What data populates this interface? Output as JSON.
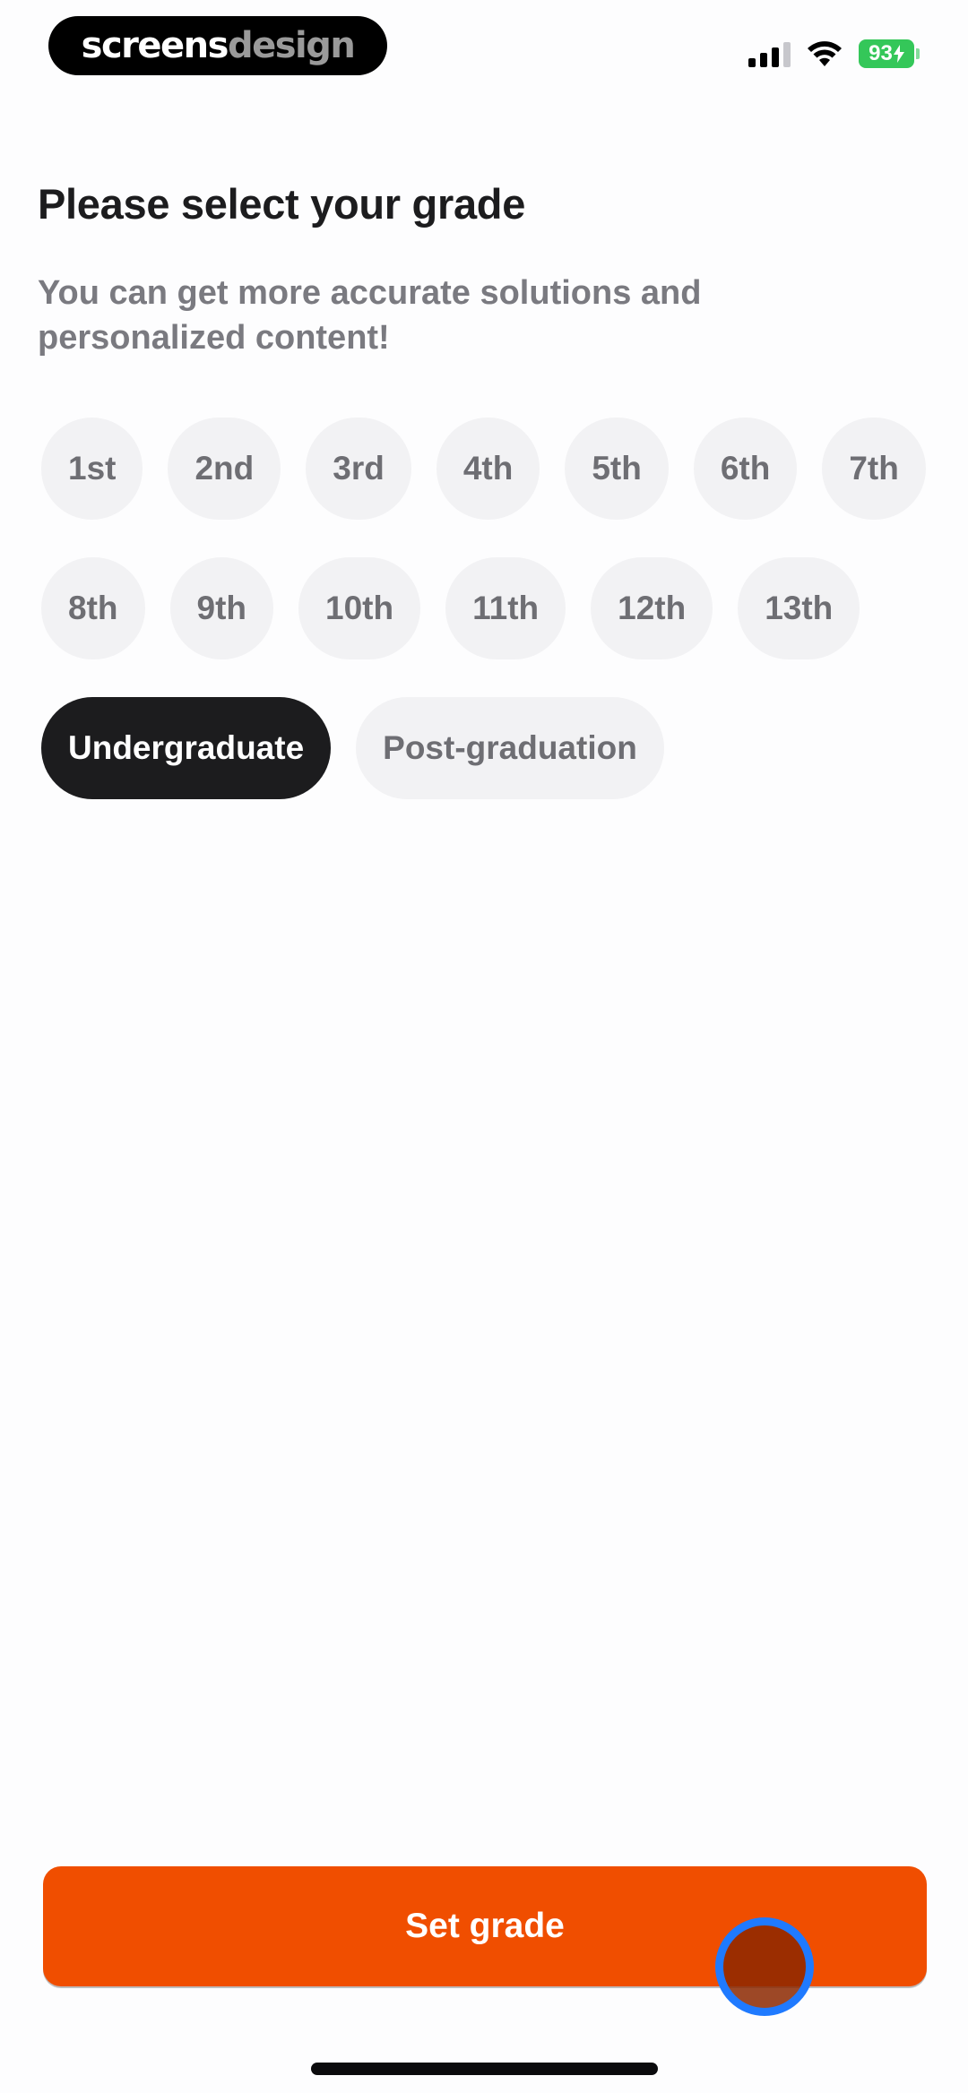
{
  "status_bar": {
    "brand_part1": "screens",
    "brand_part2": "design",
    "battery_level": "93"
  },
  "header": {
    "title": "Please select your grade",
    "subtitle": "You can get more accurate solutions and personalized content!"
  },
  "grades": {
    "selected": "Undergraduate",
    "options": [
      "1st",
      "2nd",
      "3rd",
      "4th",
      "5th",
      "6th",
      "7th",
      "8th",
      "9th",
      "10th",
      "11th",
      "12th",
      "13th",
      "Undergraduate",
      "Post-graduation"
    ]
  },
  "cta": {
    "label": "Set grade"
  },
  "colors": {
    "accent": "#f04e00",
    "selected_chip": "#1c1c1e",
    "chip_bg": "#f2f2f4",
    "battery": "#34c759"
  },
  "icons": {
    "signal": "cellular-signal-icon",
    "wifi": "wifi-icon",
    "battery": "battery-charging-icon"
  }
}
